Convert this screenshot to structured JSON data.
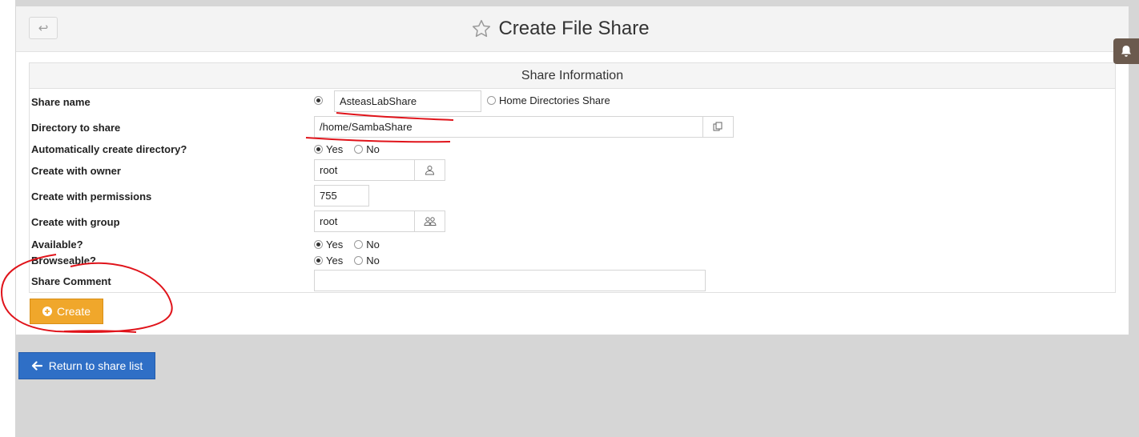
{
  "header": {
    "back_icon": "back-arrow-icon",
    "title": "Create File Share",
    "star_icon": "star-outline-icon"
  },
  "notification": {
    "icon": "bell-icon"
  },
  "section": {
    "title": "Share Information"
  },
  "fields": {
    "share_name": {
      "label": "Share name",
      "value": "AsteasLabShare",
      "alt_option": "Home Directories Share",
      "selected": "named"
    },
    "directory": {
      "label": "Directory to share",
      "value": "/home/SambaShare",
      "button_icon": "file-chooser-icon"
    },
    "auto_create": {
      "label": "Automatically create directory?",
      "yes": "Yes",
      "no": "No",
      "selected": "Yes"
    },
    "owner": {
      "label": "Create with owner",
      "value": "root",
      "button_icon": "user-icon"
    },
    "permissions": {
      "label": "Create with permissions",
      "value": "755"
    },
    "group": {
      "label": "Create with group",
      "value": "root",
      "button_icon": "group-icon"
    },
    "available": {
      "label": "Available?",
      "yes": "Yes",
      "no": "No",
      "selected": "Yes"
    },
    "browseable": {
      "label": "Browseable?",
      "yes": "Yes",
      "no": "No",
      "selected": "Yes"
    },
    "comment": {
      "label": "Share Comment",
      "value": ""
    }
  },
  "actions": {
    "create_label": "Create",
    "create_icon": "plus-circle-icon",
    "return_label": "Return to share list",
    "return_icon": "arrow-left-icon"
  },
  "colors": {
    "create_button": "#f0a72b",
    "return_button": "#2f6fc6",
    "annotation": "#e0141b"
  }
}
